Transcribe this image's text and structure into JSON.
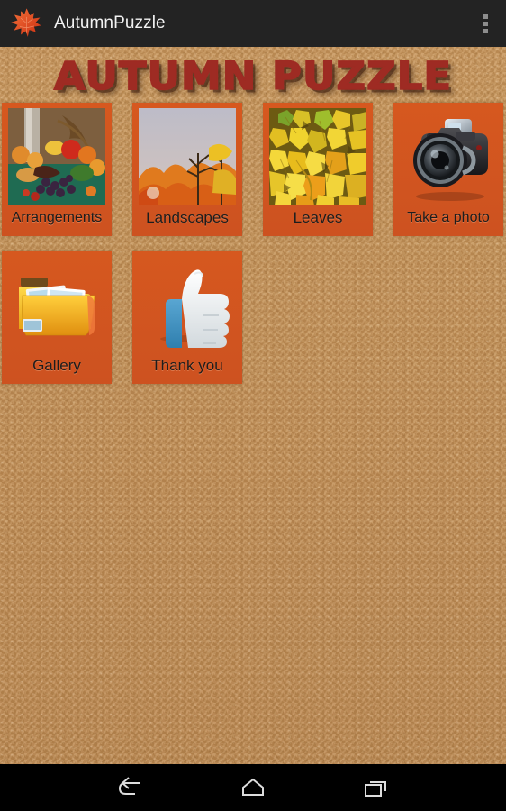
{
  "actionbar": {
    "logo_icon": "maple-leaf-icon",
    "title": "AutumnPuzzle",
    "overflow_icon": "overflow-menu-icon"
  },
  "screen": {
    "game_title": "AUTUMN PUZZLE",
    "background": "tan-leather-texture",
    "background_color": "#c08f57",
    "tile_color": "#d4561f",
    "title_color": "#9e2b23"
  },
  "tiles": [
    {
      "label": "Arrangements",
      "icon": "fruit-arrangement-photo",
      "type": "photo"
    },
    {
      "label": "Landscapes",
      "icon": "autumn-landscape-photo",
      "type": "photo"
    },
    {
      "label": "Leaves",
      "icon": "yellow-leaves-photo",
      "type": "photo"
    },
    {
      "label": "Take a photo",
      "icon": "camera-icon",
      "type": "icon"
    },
    {
      "label": "Gallery",
      "icon": "gallery-folder-icon",
      "type": "icon"
    },
    {
      "label": "Thank you",
      "icon": "thumbs-up-icon",
      "type": "icon"
    }
  ],
  "navbar": {
    "back_label": "Back",
    "home_label": "Home",
    "recents_label": "Recent apps"
  }
}
